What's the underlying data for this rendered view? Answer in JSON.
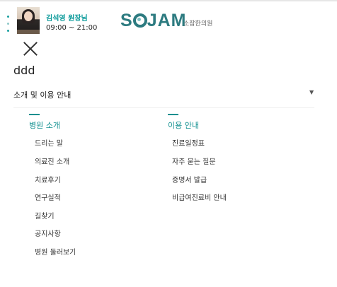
{
  "header": {
    "doctor_name": "김석영 원장님",
    "hours": "09:00 ~ 21:00",
    "logo_text": "SOJAM",
    "logo_subtitle": "소잠한의원"
  },
  "menu": {
    "input_text": "ddd",
    "section_title": "소개 및 이용 안내",
    "columns": [
      {
        "heading": "병원 소개",
        "items": [
          "드리는 말",
          "의료진 소개",
          "치료후기",
          "연구실적",
          "길찾기",
          "공지사항",
          "병원 둘러보기"
        ]
      },
      {
        "heading": "이용 안내",
        "items": [
          "진료일정표",
          "자주 묻는 질문",
          "증명서 발급",
          "비급여진료비 안내"
        ]
      }
    ]
  },
  "icons": {
    "close": "close-icon",
    "dropdown": "caret-down-icon",
    "avatar": "doctor-avatar"
  },
  "colors": {
    "accent": "#0f8f8f",
    "logo": "#2d7b80"
  }
}
